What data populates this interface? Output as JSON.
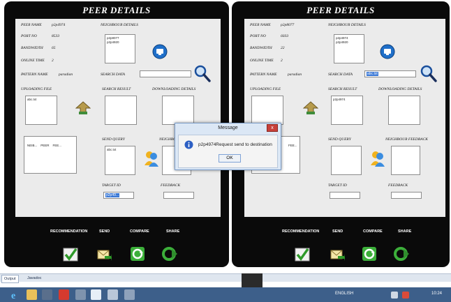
{
  "left_window": {
    "title": "PEER DETAILS",
    "peer_name_label": "PEER NAME",
    "peer_name": "p2p4974",
    "port_label": "PORT NO",
    "port": "8533",
    "bandwidth_label": "BANDWIDTH",
    "bandwidth": "65",
    "online_time_label": "ONLINE TIME",
    "online_time": "2",
    "pattern_label": "PATTERN NAME",
    "pattern": "paradian",
    "neighbour_label": "NEIGHBOUR DETAILS",
    "neighbours": [
      "p2p8077",
      "p2p4920"
    ],
    "search_data_label": "SEARCH DATA",
    "search_data": "",
    "uploading_label": "UPLOADING FILE",
    "uploading_files": [
      "abc.txt"
    ],
    "search_result_label": "SEARCH RESULT",
    "downloading_label": "DOWNLOADING DETAILS",
    "table_headers": [
      "NEIB...",
      "PEER",
      "FEE..."
    ],
    "send_query_label": "SEND QUERY",
    "send_query_value": "abc.txt",
    "neighbour_feedback_label": "NEIGHBOUR",
    "target_id_label": "TARGET ID",
    "target_id": "p2p49...",
    "feedback_label": "FEEDBACK"
  },
  "right_window": {
    "title": "PEER DETAILS",
    "peer_name_label": "PEER NAME",
    "peer_name": "p2p8077",
    "port_label": "PORT NO",
    "port": "6033",
    "bandwidth_label": "BANDWIDTH",
    "bandwidth": "22",
    "online_time_label": "ONLINE TIME",
    "online_time": "2",
    "pattern_label": "PATTERN NAME",
    "pattern": "paradian",
    "neighbour_label": "NEIGHBOUR DETAILS",
    "neighbours": [
      "p2p4974",
      "p2p4920"
    ],
    "search_data_label": "SEARCH DATA",
    "search_data": "abc.txt",
    "uploading_label": "UPLOADING FILE",
    "search_result_label": "SEARCH RESULT",
    "search_results": [
      "p2p4974"
    ],
    "downloading_label": "DOWNLOADING DETAILS",
    "table_headers": [
      "FEE..."
    ],
    "send_query_label": "SEND QUERY",
    "neighbour_feedback_label": "NEIGHBOUR FEEDBACK",
    "target_id_label": "TARGET ID",
    "feedback_label": "FEEDBACK"
  },
  "actions": {
    "recommendation": "RECOMMENDATION",
    "send": "SEND",
    "compare": "COMPARE",
    "share": "SHARE"
  },
  "dialog": {
    "title": "Message",
    "close": "x",
    "message": "p2p4974Request send to destination",
    "ok": "OK"
  },
  "ide_tabs": {
    "output": "Output",
    "javadoc": "Javadoc"
  },
  "taskbar": {
    "clock": "10:24",
    "status_text": "ENGLISH"
  },
  "colors": {
    "window_bg": "#0a0a0a",
    "panel_bg": "#ebebeb",
    "taskbar": "#3d5f8a",
    "selection": "#3a78d6"
  }
}
